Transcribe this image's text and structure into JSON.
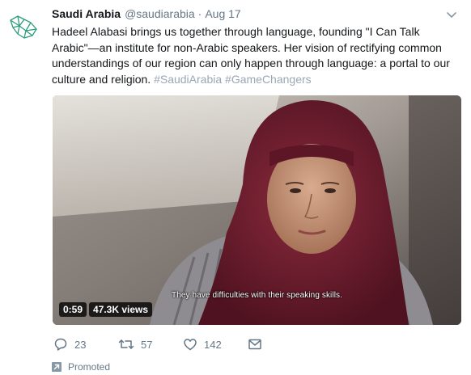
{
  "tweet": {
    "display_name": "Saudi Arabia",
    "handle": "@saudiarabia",
    "separator": "·",
    "timestamp": "Aug 17",
    "text": "Hadeel Alabasi brings us together through language, founding \"I Can Talk Arabic\"—an institute for non-Arabic speakers. Her vision of rectifying common understandings of our region can only happen through language: a portal to our culture and religion.",
    "hashtags": [
      "#SaudiArabia",
      "#GameChangers"
    ]
  },
  "video": {
    "subtitle": "They have difficulties with their speaking skills.",
    "duration": "0:59",
    "views": "47.3K views"
  },
  "actions": {
    "replies": "23",
    "retweets": "57",
    "likes": "142"
  },
  "promoted": {
    "label": "Promoted"
  },
  "colors": {
    "text": "#14171a",
    "secondary": "#657786",
    "hashtag": "#9aa7b4",
    "avatar_green": "#2e9c7d"
  },
  "icons": {
    "avatar": "saudi-map-logo-icon",
    "caret": "chevron-down-icon",
    "reply": "reply-icon",
    "retweet": "retweet-icon",
    "like": "heart-icon",
    "message": "envelope-icon",
    "promoted": "promoted-arrow-icon"
  }
}
